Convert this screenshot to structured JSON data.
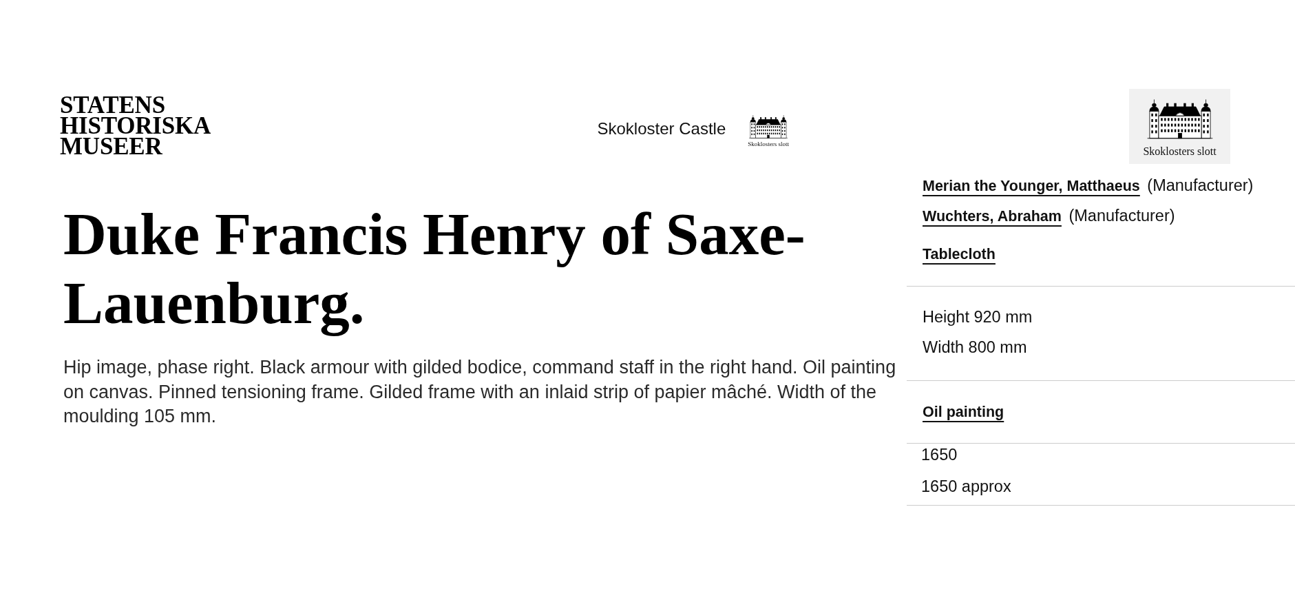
{
  "header": {
    "museum_logo": {
      "lines": [
        "STATENS",
        "HISTORISKA",
        "MUSEER"
      ]
    },
    "site_name": "Skokloster Castle",
    "site_logo": {
      "caption": "Skoklosters slott"
    }
  },
  "side_logo": {
    "caption": "Skoklosters slott"
  },
  "object": {
    "title": "Duke Francis Henry of Saxe-Lauenburg.",
    "description": "Hip image, phase right. Black armour with gilded bodice, command staff in the right hand. Oil painting on canvas. Pinned tensioning frame. Gilded frame with an inlaid strip of papier mâché. Width of the moulding 105 mm."
  },
  "details": {
    "sections": [
      {
        "kind": "credits",
        "items": [
          {
            "kind": "person",
            "name": "Merian the Younger, Matthaeus",
            "role": "(Manufacturer)"
          },
          {
            "kind": "person",
            "name": "Wuchters, Abraham",
            "role": "(Manufacturer)"
          },
          {
            "kind": "link",
            "text": "Tablecloth"
          }
        ]
      },
      {
        "kind": "measurements",
        "items": [
          {
            "kind": "text",
            "text": "Height 920 mm"
          },
          {
            "kind": "text",
            "text": "Width 800 mm"
          }
        ]
      },
      {
        "kind": "technique",
        "items": [
          {
            "kind": "link",
            "text": "Oil painting"
          }
        ]
      },
      {
        "kind": "dating",
        "items": [
          {
            "kind": "text",
            "text": "1650"
          },
          {
            "kind": "text",
            "text": "1650 approx"
          }
        ]
      }
    ]
  }
}
